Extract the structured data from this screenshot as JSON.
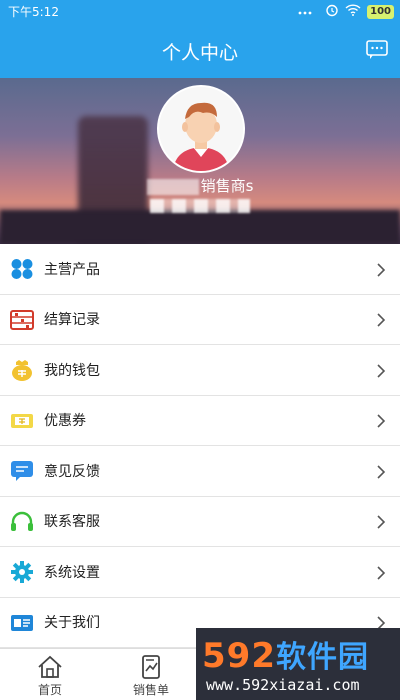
{
  "status_bar": {
    "time": "下午5:12",
    "battery": "100"
  },
  "header": {
    "title": "个人中心",
    "message_icon": "message-icon"
  },
  "profile": {
    "username_suffix": "销售商s"
  },
  "menu": [
    {
      "label": "主营产品",
      "icon": "product-icon",
      "color": "#1a8fe0"
    },
    {
      "label": "结算记录",
      "icon": "abacus-icon",
      "color": "#d23b2b"
    },
    {
      "label": "我的钱包",
      "icon": "wallet-icon",
      "color": "#f2c230"
    },
    {
      "label": "优惠券",
      "icon": "coupon-icon",
      "color": "#e8c72a"
    },
    {
      "label": "意见反馈",
      "icon": "feedback-icon",
      "color": "#2f8ee8"
    },
    {
      "label": "联系客服",
      "icon": "headset-icon",
      "color": "#3bbf3b"
    },
    {
      "label": "系统设置",
      "icon": "gear-icon",
      "color": "#19a9d6"
    },
    {
      "label": "关于我们",
      "icon": "about-icon",
      "color": "#1f86d8"
    }
  ],
  "tabs": [
    {
      "label": "首页",
      "icon": "home-icon"
    },
    {
      "label": "销售单",
      "icon": "sales-order-icon"
    }
  ],
  "watermark": {
    "brand": "592",
    "brand_cn": "软件园",
    "url": "www.592xiazai.com"
  },
  "colors": {
    "primary": "#29a3ec"
  }
}
